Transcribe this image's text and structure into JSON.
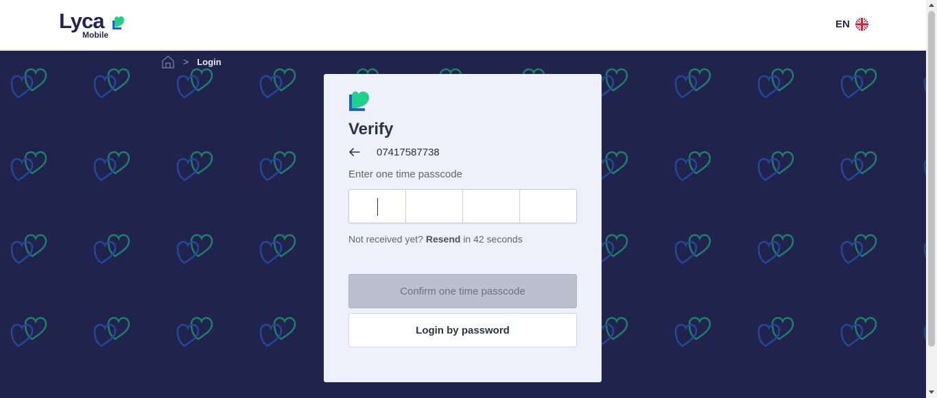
{
  "header": {
    "logo_text": "Lyca",
    "logo_subtext": "Mobile",
    "language_label": "EN",
    "language_flag_icon": "uk-flag-icon"
  },
  "breadcrumb": {
    "home_icon": "home-icon",
    "separator": ">",
    "current": "Login"
  },
  "verify": {
    "title": "Verify",
    "back_icon": "arrow-left-icon",
    "phone_number": "07417587738",
    "otp_label": "Enter one time passcode",
    "otp_digits": [
      "",
      "",
      "",
      ""
    ],
    "resend_prefix": "Not received yet?",
    "resend_link": "Resend",
    "resend_suffix": "in 42 seconds",
    "confirm_button": "Confirm one time passcode",
    "password_button": "Login by password"
  },
  "colors": {
    "brand_navy": "#20244d",
    "brand_green": "#1fd28b",
    "brand_blue": "#1f5fc9",
    "card_bg": "#eef0fb",
    "button_disabled": "#bcc0ce"
  }
}
